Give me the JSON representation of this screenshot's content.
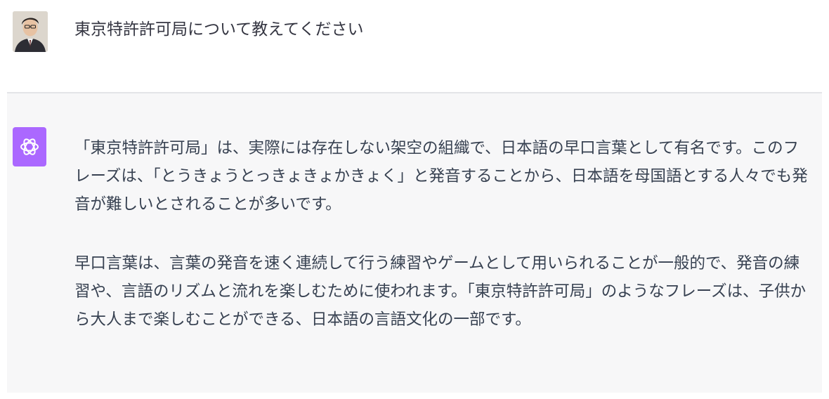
{
  "user": {
    "avatar_icon": "user-avatar-photo",
    "message": "東京特許許可局について教えてください"
  },
  "assistant": {
    "avatar_icon": "openai-logo-icon",
    "accent_color": "#ab68ff",
    "paragraphs": [
      "「東京特許許可局」は、実際には存在しない架空の組織で、日本語の早口言葉として有名です。このフレーズは、「とうきょうとっきょきょかきょく」と発音することから、日本語を母国語とする人々でも発音が難しいとされることが多いです。",
      "早口言葉は、言葉の発音を速く連続して行う練習やゲームとして用いられることが一般的で、発音の練習や、言語のリズムと流れを楽しむために使われます。「東京特許許可局」のようなフレーズは、子供から大人まで楽しむことができる、日本語の言語文化の一部です。"
    ]
  },
  "colors": {
    "user_bg": "#ffffff",
    "assistant_bg": "#f7f7f8",
    "text": "#374151",
    "divider": "#e3e4e8"
  }
}
